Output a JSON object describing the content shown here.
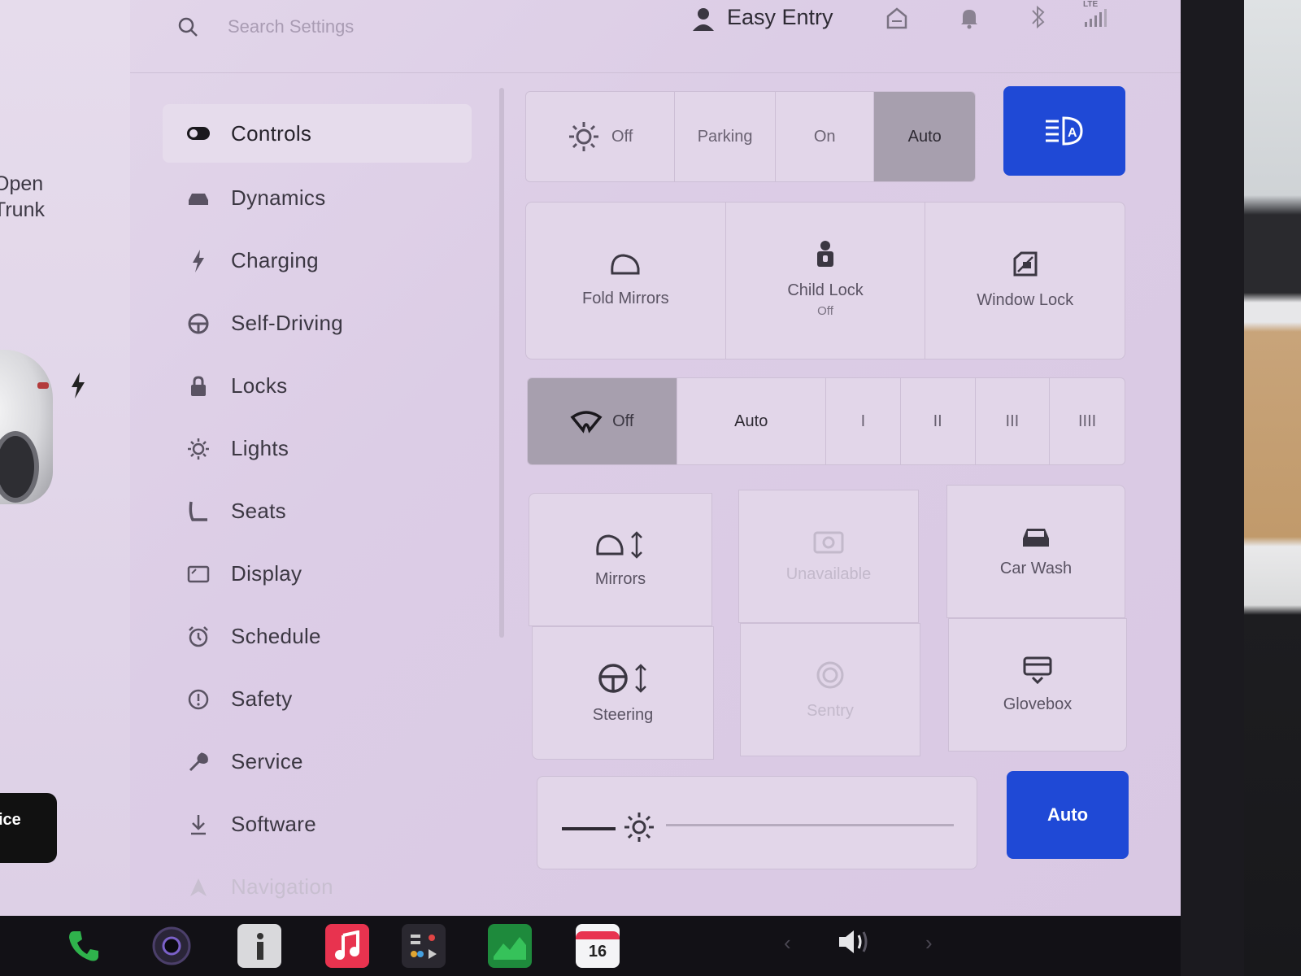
{
  "car_panel": {
    "trunk_line1": "Open",
    "trunk_line2": "Trunk",
    "pill_text": "ice"
  },
  "topbar": {
    "search_placeholder": "Search Settings",
    "profile_name": "Easy Entry",
    "signal_label": "LTE"
  },
  "sidebar": {
    "items": [
      {
        "label": "Controls",
        "icon": "toggle-icon",
        "active": true
      },
      {
        "label": "Dynamics",
        "icon": "car-icon"
      },
      {
        "label": "Charging",
        "icon": "bolt-icon"
      },
      {
        "label": "Self-Driving",
        "icon": "steering-wheel-icon"
      },
      {
        "label": "Locks",
        "icon": "lock-icon"
      },
      {
        "label": "Lights",
        "icon": "sun-icon"
      },
      {
        "label": "Seats",
        "icon": "seat-icon"
      },
      {
        "label": "Display",
        "icon": "display-icon"
      },
      {
        "label": "Schedule",
        "icon": "alarm-clock-icon"
      },
      {
        "label": "Safety",
        "icon": "alert-circle-icon"
      },
      {
        "label": "Service",
        "icon": "wrench-icon"
      },
      {
        "label": "Software",
        "icon": "download-icon"
      },
      {
        "label": "Navigation",
        "icon": "navigation-icon"
      }
    ]
  },
  "headlights": {
    "options": [
      "Off",
      "Parking",
      "On",
      "Auto"
    ],
    "selected": "Auto"
  },
  "actions_row1": [
    {
      "label": "Fold Mirrors",
      "sub": ""
    },
    {
      "label": "Child Lock",
      "sub": "Off"
    },
    {
      "label": "Window Lock",
      "sub": ""
    }
  ],
  "wipers": {
    "options": [
      "Off",
      "Auto",
      "I",
      "II",
      "III",
      "IIII"
    ],
    "selected": "Off"
  },
  "actions_grid": [
    {
      "label": "Mirrors",
      "icon": "mirror-adjust-icon"
    },
    {
      "label": "Unavailable",
      "icon": "camera-icon",
      "disabled": true
    },
    {
      "label": "Car Wash",
      "icon": "car-icon"
    },
    {
      "label": "Steering",
      "icon": "steering-adjust-icon"
    },
    {
      "label": "Sentry",
      "icon": "sentry-icon",
      "disabled": true
    },
    {
      "label": "Glovebox",
      "icon": "glovebox-icon"
    }
  ],
  "brightness": {
    "auto_label": "Auto"
  },
  "dock": {
    "calendar_day": "16"
  },
  "colors": {
    "accent_blue": "#1f49d6",
    "background": "#dccde6"
  }
}
